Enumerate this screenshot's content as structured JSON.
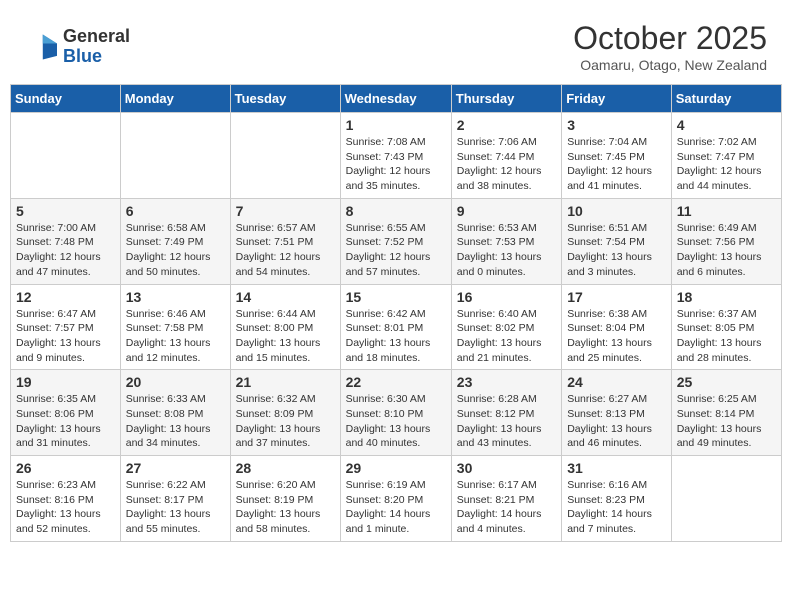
{
  "header": {
    "logo_general": "General",
    "logo_blue": "Blue",
    "month_title": "October 2025",
    "location": "Oamaru, Otago, New Zealand"
  },
  "weekdays": [
    "Sunday",
    "Monday",
    "Tuesday",
    "Wednesday",
    "Thursday",
    "Friday",
    "Saturday"
  ],
  "weeks": [
    [
      {
        "day": "",
        "info": ""
      },
      {
        "day": "",
        "info": ""
      },
      {
        "day": "",
        "info": ""
      },
      {
        "day": "1",
        "info": "Sunrise: 7:08 AM\nSunset: 7:43 PM\nDaylight: 12 hours\nand 35 minutes."
      },
      {
        "day": "2",
        "info": "Sunrise: 7:06 AM\nSunset: 7:44 PM\nDaylight: 12 hours\nand 38 minutes."
      },
      {
        "day": "3",
        "info": "Sunrise: 7:04 AM\nSunset: 7:45 PM\nDaylight: 12 hours\nand 41 minutes."
      },
      {
        "day": "4",
        "info": "Sunrise: 7:02 AM\nSunset: 7:47 PM\nDaylight: 12 hours\nand 44 minutes."
      }
    ],
    [
      {
        "day": "5",
        "info": "Sunrise: 7:00 AM\nSunset: 7:48 PM\nDaylight: 12 hours\nand 47 minutes."
      },
      {
        "day": "6",
        "info": "Sunrise: 6:58 AM\nSunset: 7:49 PM\nDaylight: 12 hours\nand 50 minutes."
      },
      {
        "day": "7",
        "info": "Sunrise: 6:57 AM\nSunset: 7:51 PM\nDaylight: 12 hours\nand 54 minutes."
      },
      {
        "day": "8",
        "info": "Sunrise: 6:55 AM\nSunset: 7:52 PM\nDaylight: 12 hours\nand 57 minutes."
      },
      {
        "day": "9",
        "info": "Sunrise: 6:53 AM\nSunset: 7:53 PM\nDaylight: 13 hours\nand 0 minutes."
      },
      {
        "day": "10",
        "info": "Sunrise: 6:51 AM\nSunset: 7:54 PM\nDaylight: 13 hours\nand 3 minutes."
      },
      {
        "day": "11",
        "info": "Sunrise: 6:49 AM\nSunset: 7:56 PM\nDaylight: 13 hours\nand 6 minutes."
      }
    ],
    [
      {
        "day": "12",
        "info": "Sunrise: 6:47 AM\nSunset: 7:57 PM\nDaylight: 13 hours\nand 9 minutes."
      },
      {
        "day": "13",
        "info": "Sunrise: 6:46 AM\nSunset: 7:58 PM\nDaylight: 13 hours\nand 12 minutes."
      },
      {
        "day": "14",
        "info": "Sunrise: 6:44 AM\nSunset: 8:00 PM\nDaylight: 13 hours\nand 15 minutes."
      },
      {
        "day": "15",
        "info": "Sunrise: 6:42 AM\nSunset: 8:01 PM\nDaylight: 13 hours\nand 18 minutes."
      },
      {
        "day": "16",
        "info": "Sunrise: 6:40 AM\nSunset: 8:02 PM\nDaylight: 13 hours\nand 21 minutes."
      },
      {
        "day": "17",
        "info": "Sunrise: 6:38 AM\nSunset: 8:04 PM\nDaylight: 13 hours\nand 25 minutes."
      },
      {
        "day": "18",
        "info": "Sunrise: 6:37 AM\nSunset: 8:05 PM\nDaylight: 13 hours\nand 28 minutes."
      }
    ],
    [
      {
        "day": "19",
        "info": "Sunrise: 6:35 AM\nSunset: 8:06 PM\nDaylight: 13 hours\nand 31 minutes."
      },
      {
        "day": "20",
        "info": "Sunrise: 6:33 AM\nSunset: 8:08 PM\nDaylight: 13 hours\nand 34 minutes."
      },
      {
        "day": "21",
        "info": "Sunrise: 6:32 AM\nSunset: 8:09 PM\nDaylight: 13 hours\nand 37 minutes."
      },
      {
        "day": "22",
        "info": "Sunrise: 6:30 AM\nSunset: 8:10 PM\nDaylight: 13 hours\nand 40 minutes."
      },
      {
        "day": "23",
        "info": "Sunrise: 6:28 AM\nSunset: 8:12 PM\nDaylight: 13 hours\nand 43 minutes."
      },
      {
        "day": "24",
        "info": "Sunrise: 6:27 AM\nSunset: 8:13 PM\nDaylight: 13 hours\nand 46 minutes."
      },
      {
        "day": "25",
        "info": "Sunrise: 6:25 AM\nSunset: 8:14 PM\nDaylight: 13 hours\nand 49 minutes."
      }
    ],
    [
      {
        "day": "26",
        "info": "Sunrise: 6:23 AM\nSunset: 8:16 PM\nDaylight: 13 hours\nand 52 minutes."
      },
      {
        "day": "27",
        "info": "Sunrise: 6:22 AM\nSunset: 8:17 PM\nDaylight: 13 hours\nand 55 minutes."
      },
      {
        "day": "28",
        "info": "Sunrise: 6:20 AM\nSunset: 8:19 PM\nDaylight: 13 hours\nand 58 minutes."
      },
      {
        "day": "29",
        "info": "Sunrise: 6:19 AM\nSunset: 8:20 PM\nDaylight: 14 hours\nand 1 minute."
      },
      {
        "day": "30",
        "info": "Sunrise: 6:17 AM\nSunset: 8:21 PM\nDaylight: 14 hours\nand 4 minutes."
      },
      {
        "day": "31",
        "info": "Sunrise: 6:16 AM\nSunset: 8:23 PM\nDaylight: 14 hours\nand 7 minutes."
      },
      {
        "day": "",
        "info": ""
      }
    ]
  ]
}
